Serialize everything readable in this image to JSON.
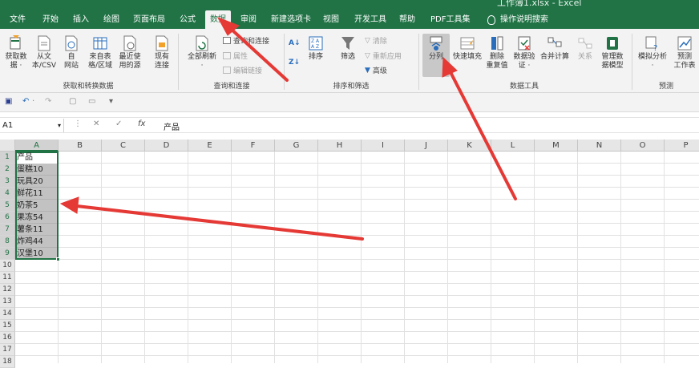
{
  "window": {
    "title": "工作簿1.xlsx - Excel"
  },
  "menu": [
    "文件",
    "开始",
    "插入",
    "绘图",
    "页面布局",
    "公式",
    "数据",
    "审阅",
    "新建选项卡",
    "视图",
    "开发工具",
    "帮助",
    "PDF工具集"
  ],
  "menu_active": "数据",
  "tell_me": "操作说明搜索",
  "ribbon": {
    "get_data": {
      "get_data": "获取数\n据 ·",
      "from_text": "从文\n本/CSV",
      "from_web": "自\n网站",
      "from_table": "来自表\n格/区域",
      "recent": "最近使\n用的源",
      "existing": "现有\n连接",
      "label": "获取和转换数据"
    },
    "queries": {
      "refresh_all": "全部刷新\n·",
      "queries_conn": "查询和连接",
      "properties": "属性",
      "edit_links": "编辑链接",
      "label": "查询和连接"
    },
    "sort_filter": {
      "sort": "排序",
      "filter": "筛选",
      "clear": "清除",
      "reapply": "重新应用",
      "advanced": "高级",
      "label": "排序和筛选"
    },
    "data_tools": {
      "split": "分列",
      "flash_fill": "快速填充",
      "remove_dup": "删除\n重复值",
      "validate": "数据验\n证 ·",
      "consolidate": "合并计算",
      "relations": "关系",
      "data_model": "管理数\n据模型",
      "label": "数据工具"
    },
    "forecast": {
      "what_if": "模拟分析\n·",
      "forecast_sheet": "预测\n工作表",
      "label": "预测"
    }
  },
  "formula": {
    "name_box": "A1",
    "value": "产品"
  },
  "columns": [
    "A",
    "B",
    "C",
    "D",
    "E",
    "F",
    "G",
    "H",
    "I",
    "J",
    "K",
    "L",
    "M",
    "N",
    "O",
    "P"
  ],
  "rows": [
    "1",
    "2",
    "3",
    "4",
    "5",
    "6",
    "7",
    "8",
    "9",
    "10",
    "11",
    "12",
    "13",
    "14",
    "15",
    "16",
    "17",
    "18"
  ],
  "cells_A": [
    "产品",
    "蛋糕10",
    "玩具20",
    "鲜花11",
    "奶茶5",
    "果冻54",
    "薯条11",
    "炸鸡44",
    "汉堡10"
  ],
  "colors": {
    "excel_green": "#217346",
    "arrow_red": "#e53935"
  }
}
